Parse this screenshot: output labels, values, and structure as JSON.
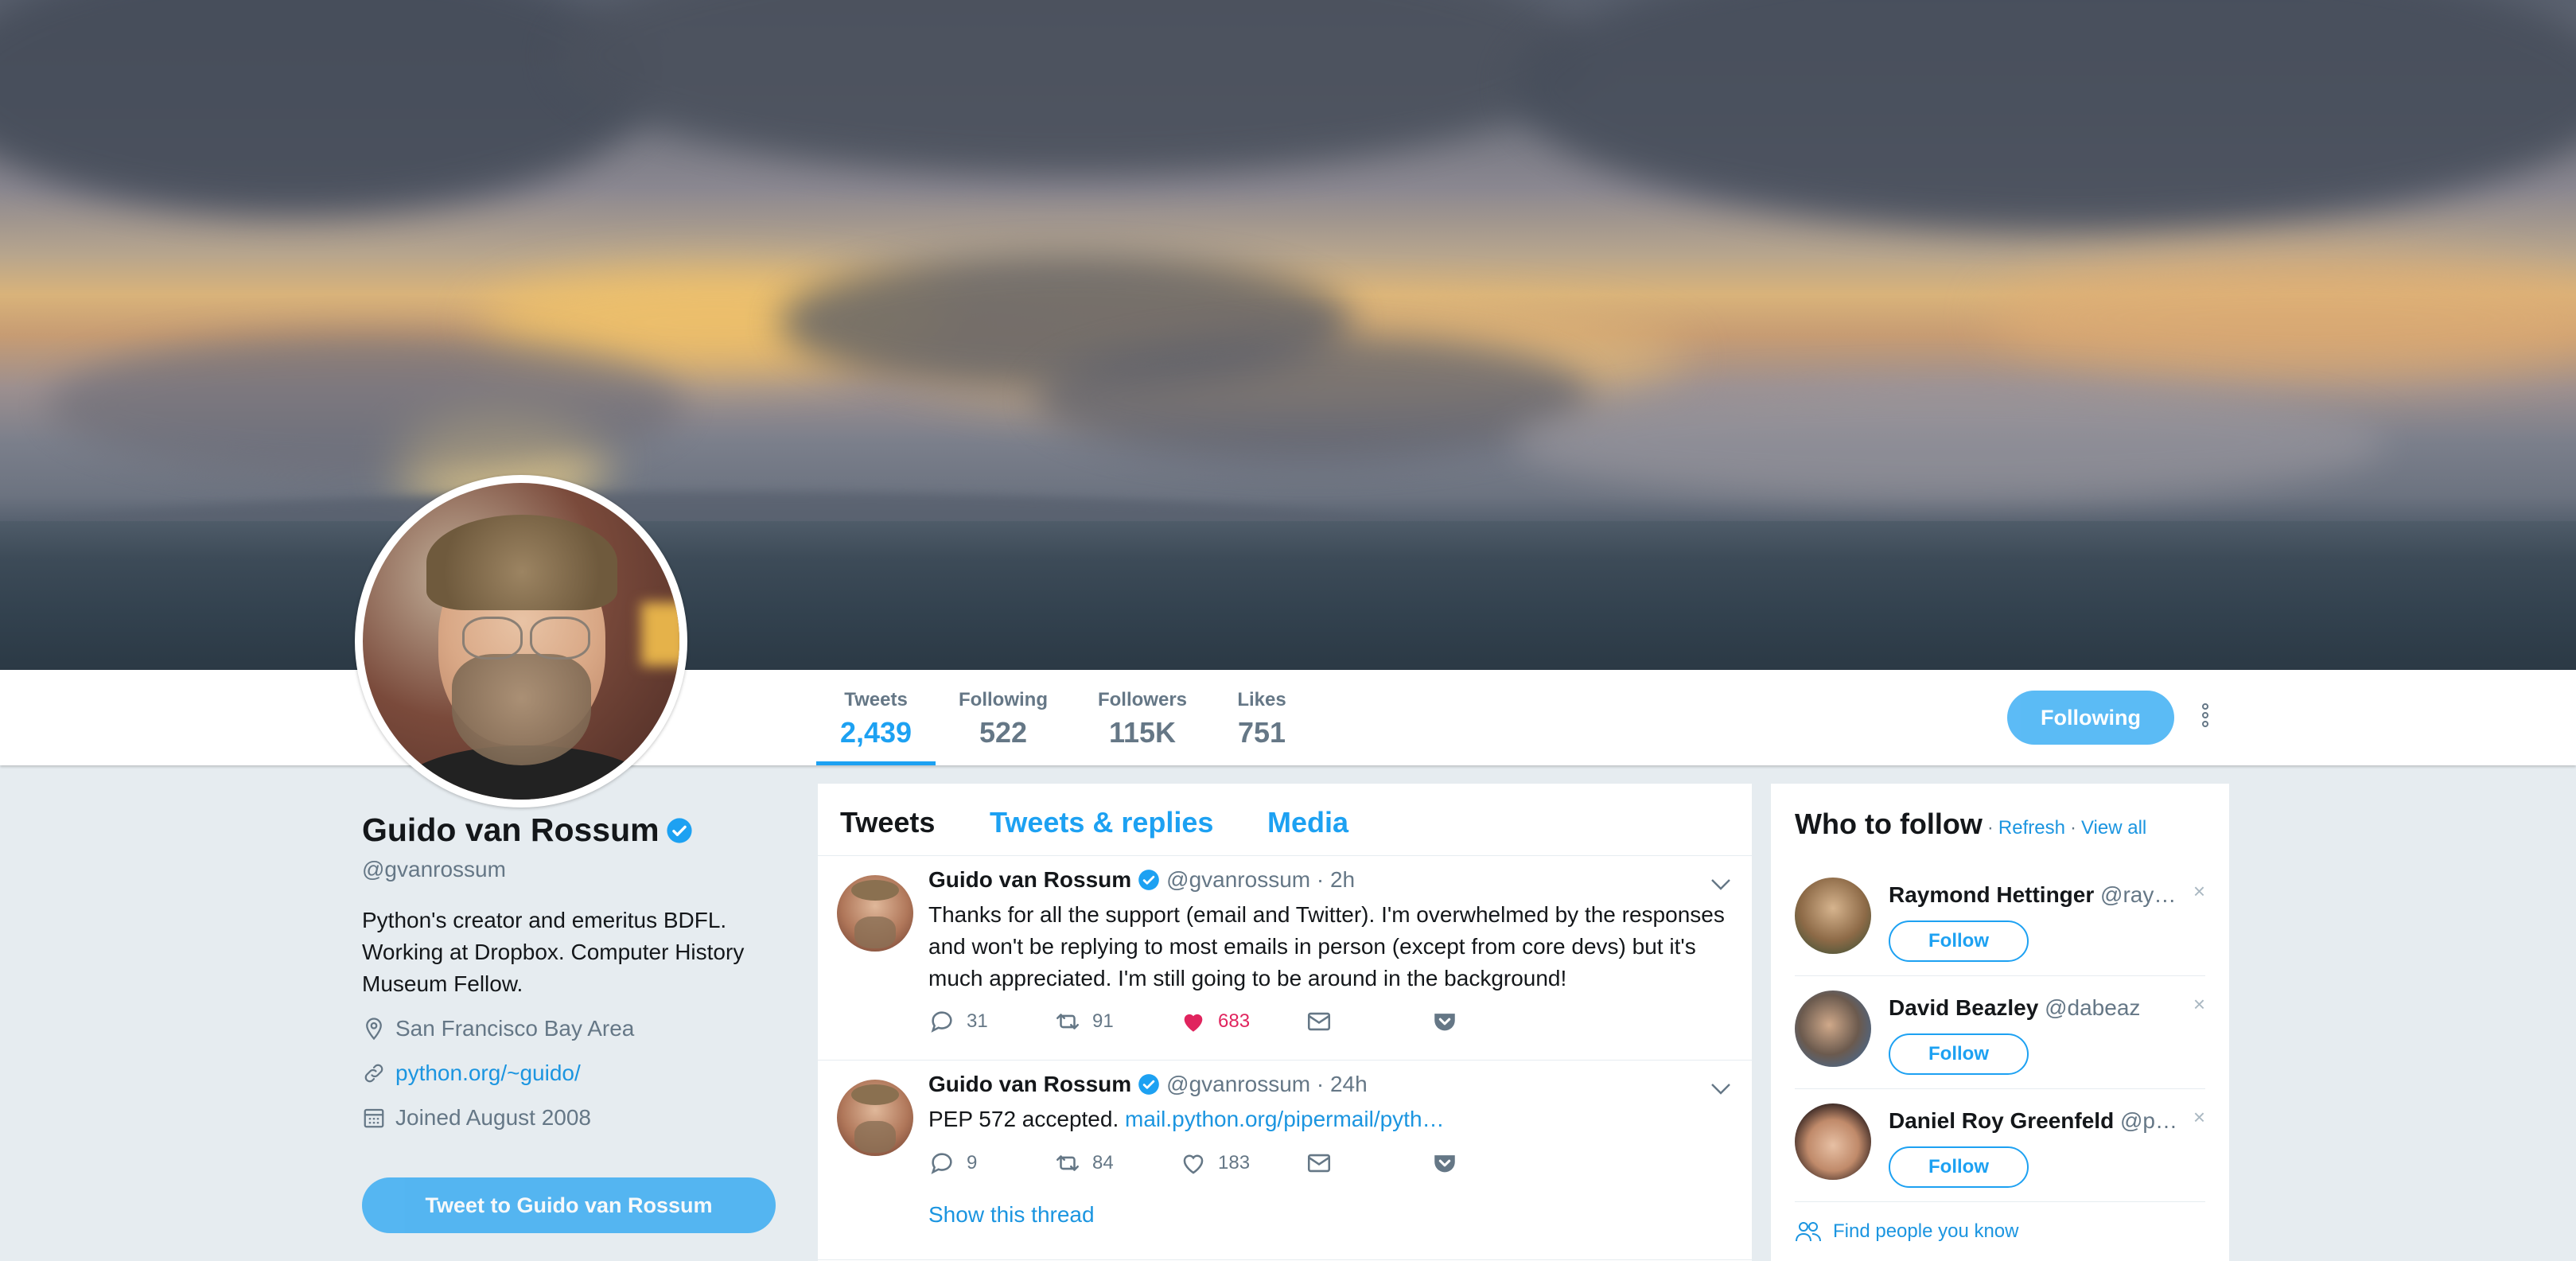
{
  "nav": {
    "stats": [
      {
        "label": "Tweets",
        "value": "2,439"
      },
      {
        "label": "Following",
        "value": "522"
      },
      {
        "label": "Followers",
        "value": "115K"
      },
      {
        "label": "Likes",
        "value": "751"
      }
    ],
    "following_button": "Following",
    "more_icon": "more-vertical-icon"
  },
  "profile": {
    "name": "Guido van Rossum",
    "handle": "@gvanrossum",
    "bio": "Python's creator and emeritus BDFL.\nWorking at Dropbox. Computer History\nMuseum Fellow.",
    "location": "San Francisco Bay Area",
    "website": "python.org/~guido/",
    "joined": "Joined August 2008",
    "tweet_to_button": "Tweet to Guido van Rossum"
  },
  "timeline": {
    "tabs": [
      "Tweets",
      "Tweets & replies",
      "Media"
    ],
    "tweets": [
      {
        "name": "Guido van Rossum",
        "meta": "@gvanrossum · 2h",
        "text": "Thanks for all the support (email and Twitter). I'm overwhelmed by the responses and won't be replying to most emails in person (except from core devs) but it's much appreciated. I'm still going to be around in the background!",
        "replies": "31",
        "retweets": "91",
        "likes": "683"
      },
      {
        "name": "Guido van Rossum",
        "meta": "@gvanrossum · 24h",
        "text": "PEP 572 accepted. ",
        "link": "mail.python.org/pipermail/pyth…",
        "replies": "9",
        "retweets": "84",
        "likes": "183",
        "thread_link": "Show this thread"
      }
    ]
  },
  "who_to_follow": {
    "title": "Who to follow",
    "sep": "·",
    "refresh": "Refresh",
    "view_all": "View all",
    "items": [
      {
        "name": "Raymond Hettinger",
        "handle": "@ray…",
        "button": "Follow"
      },
      {
        "name": "David Beazley",
        "handle": "@dabeaz",
        "button": "Follow"
      },
      {
        "name": "Daniel Roy Greenfeld",
        "handle": "@p…",
        "button": "Follow"
      }
    ],
    "close_glyph": "×",
    "find_people": "Find people you know"
  },
  "colors": {
    "accent": "#1da1f2",
    "like": "#e0245e",
    "muted": "#657786",
    "page_bg": "#e6ecf0"
  }
}
